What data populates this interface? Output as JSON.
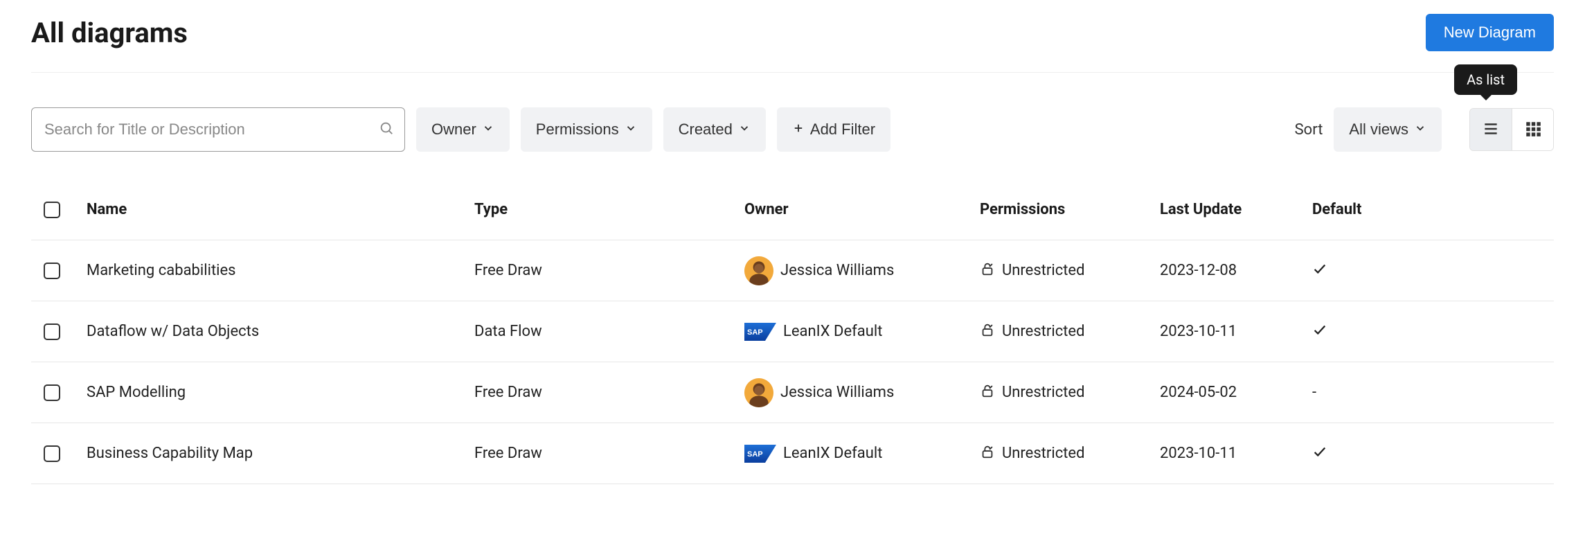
{
  "page": {
    "title": "All diagrams",
    "new_button": "New Diagram",
    "tooltip_list": "As list"
  },
  "search": {
    "placeholder": "Search for Title or Description"
  },
  "filters": {
    "owner": "Owner",
    "permissions": "Permissions",
    "created": "Created",
    "add": "Add Filter"
  },
  "sort": {
    "label": "Sort",
    "views": "All views"
  },
  "columns": {
    "name": "Name",
    "type": "Type",
    "owner": "Owner",
    "permissions": "Permissions",
    "last_update": "Last Update",
    "default": "Default"
  },
  "rows": [
    {
      "name": "Marketing cababilities",
      "type": "Free Draw",
      "owner_kind": "person",
      "owner": "Jessica Williams",
      "permissions": "Unrestricted",
      "last_update": "2023-12-08",
      "default": "check"
    },
    {
      "name": "Dataflow w/ Data Objects",
      "type": "Data Flow",
      "owner_kind": "sap",
      "owner": "LeanIX Default",
      "permissions": "Unrestricted",
      "last_update": "2023-10-11",
      "default": "check"
    },
    {
      "name": "SAP Modelling",
      "type": "Free Draw",
      "owner_kind": "person",
      "owner": "Jessica Williams",
      "permissions": "Unrestricted",
      "last_update": "2024-05-02",
      "default": "dash"
    },
    {
      "name": "Business Capability Map",
      "type": "Free Draw",
      "owner_kind": "sap",
      "owner": "LeanIX Default",
      "permissions": "Unrestricted",
      "last_update": "2023-10-11",
      "default": "check"
    }
  ]
}
